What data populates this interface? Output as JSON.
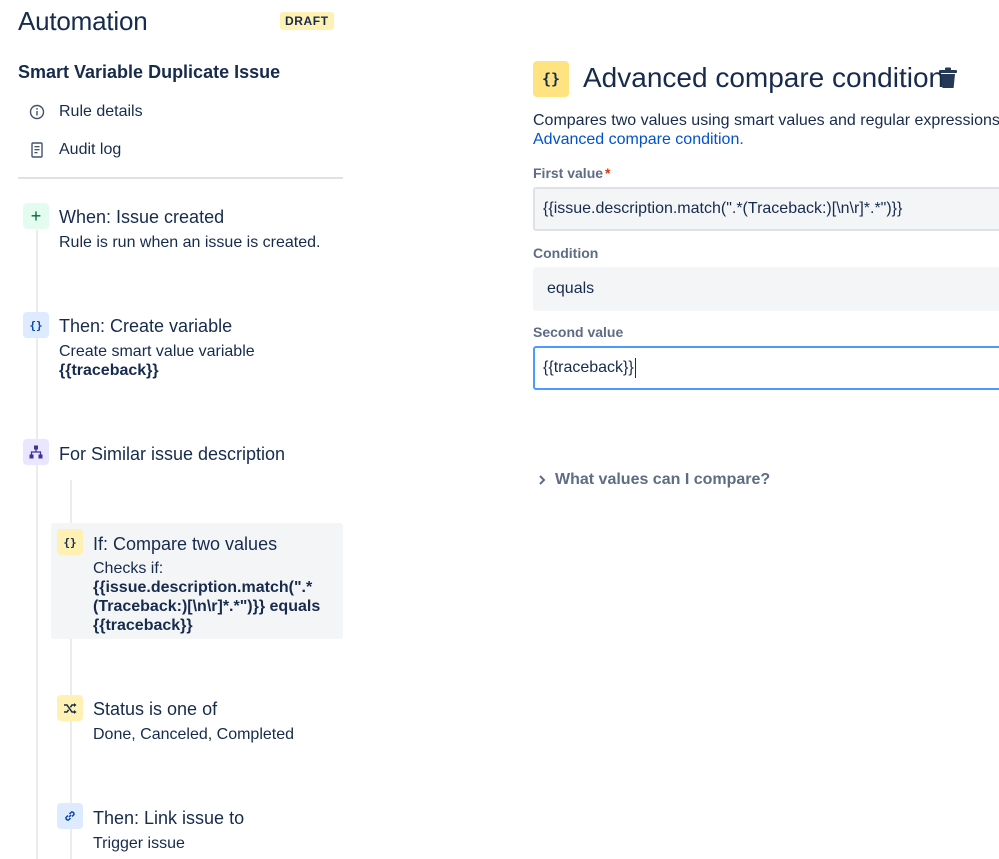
{
  "header": {
    "title": "Automation",
    "badge": "DRAFT"
  },
  "rule": {
    "name": "Smart Variable Duplicate Issue"
  },
  "sidebar": {
    "links": [
      {
        "label": "Rule details",
        "icon": "info-icon"
      },
      {
        "label": "Audit log",
        "icon": "document-icon"
      }
    ]
  },
  "steps": {
    "trigger": {
      "icon_text": "+",
      "title": "When: Issue created",
      "desc": "Rule is run when an issue is created."
    },
    "create_variable": {
      "icon_text": "{}",
      "title": "Then: Create variable",
      "desc": "Create smart value variable",
      "desc_value": "{{traceback}}"
    },
    "branch": {
      "title": "For Similar issue description"
    },
    "compare": {
      "icon_text": "{}",
      "title": "If: Compare two values",
      "desc_prefix": "Checks if:",
      "line1": "{{issue.description.match(\".*",
      "line2": "(Traceback:)[\\n\\r]*.*\")}} equals",
      "line3": "{{traceback}}"
    },
    "status": {
      "title": "Status is one of",
      "desc": "Done, Canceled, Completed"
    },
    "link": {
      "title": "Then: Link issue to",
      "desc": "Trigger issue"
    }
  },
  "panel": {
    "icon_text": "{}",
    "title": "Advanced compare condition",
    "description": "Compares two values using smart values and regular expressions.",
    "link_text": "Advanced compare condition.",
    "first_value": {
      "label": "First value",
      "required_mark": "*",
      "value": "{{issue.description.match(\".*(Traceback:)[\\n\\r]*.*\")}}"
    },
    "condition": {
      "label": "Condition",
      "value": "equals"
    },
    "second_value": {
      "label": "Second value",
      "value": "{{traceback}}"
    },
    "expander": {
      "label": "What values can I compare?"
    }
  },
  "colors": {
    "text": "#172b4d",
    "subtle": "#5e6c84",
    "link": "#0052cc",
    "badge_bg": "#fff0b3",
    "focus_border": "#4c9aff",
    "required": "#de350b"
  }
}
